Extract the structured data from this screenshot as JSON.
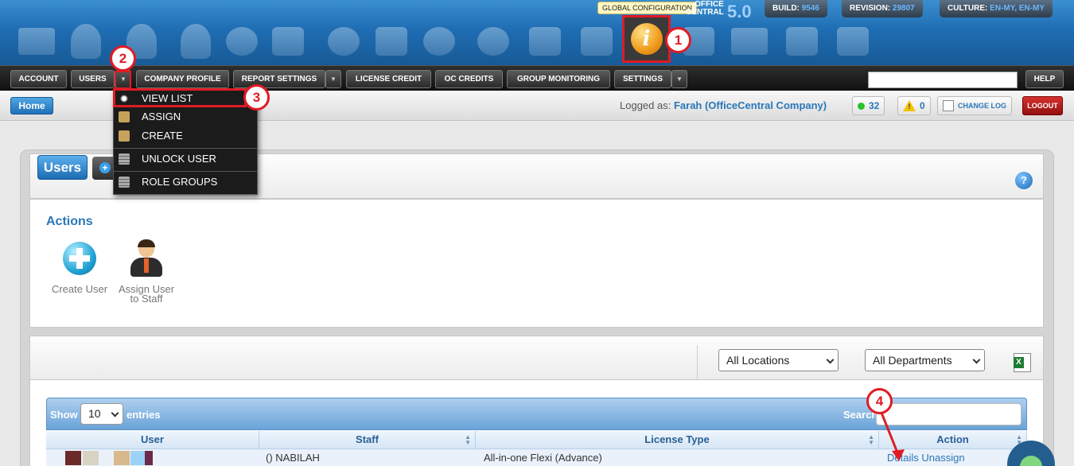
{
  "header": {
    "tooltip": "GLOBAL CONFIGURATION",
    "brand_line1": "OFFICE",
    "brand_line2": "CENTRAL",
    "version": "5.0",
    "build_label": "BUILD:",
    "build_value": "9546",
    "revision_label": "REVISION:",
    "revision_value": "29807",
    "culture_label": "CULTURE:",
    "culture_value": "EN-MY, EN-MY",
    "global_config_glyph": "i",
    "module_icons": [
      "monitor-icon",
      "user-icon",
      "user-icon",
      "user-icon",
      "cart-icon",
      "envelope-icon",
      "pie-chart-icon",
      "document-icon",
      "phone-icon",
      "chat-icon",
      "clipboard-icon",
      "truck-icon",
      "info-icon",
      "pen-icon",
      "monitor-icon",
      "lock-icon",
      "truck-icon"
    ]
  },
  "nav": {
    "account": "ACCOUNT",
    "users": "USERS",
    "company_profile": "COMPANY PROFILE",
    "report_settings": "REPORT SETTINGS",
    "license_credit": "LICENSE CREDIT",
    "oc_credits": "OC CREDITS",
    "group_monitoring": "GROUP MONITORING",
    "settings": "SETTINGS",
    "help": "HELP",
    "arrow": "▼"
  },
  "users_menu": {
    "view_list": "VIEW LIST",
    "assign": "ASSIGN",
    "create": "CREATE",
    "unlock_user": "UNLOCK USER",
    "role_groups": "ROLE GROUPS"
  },
  "subbar": {
    "home": "Home",
    "logged_as": "Logged as:",
    "user_name": "Farah (OfficeCentral Company)",
    "online_count": "32",
    "warning_glyph": "!",
    "alert_count": "0",
    "change_log": "CHANGE LOG",
    "logout": "LOGOUT"
  },
  "page": {
    "title": "Users",
    "add_glyph": "+",
    "help_glyph": "?",
    "actions_title": "Actions",
    "action_create": "Create User",
    "action_assign_line1": "Assign User",
    "action_assign_line2": "to Staff"
  },
  "filters": {
    "location": "All Locations",
    "department": "All Departments"
  },
  "table": {
    "show_label": "Show",
    "entries_value": "10",
    "entries_label": "entries",
    "search_label": "Search:",
    "columns": [
      "User",
      "Staff",
      "License Type",
      "Action"
    ],
    "rows": [
      {
        "staff": "() NABILAH",
        "license": "All-in-one Flexi (Advance)",
        "action_details": "Details",
        "action_unassign": "Unassign"
      }
    ]
  },
  "callouts": [
    "1",
    "2",
    "3",
    "4"
  ],
  "colors": {
    "header_blue": "#1f6db3",
    "link_blue": "#2a77b8",
    "callout_red": "#e01b24",
    "logout_red": "#b01e1a"
  }
}
